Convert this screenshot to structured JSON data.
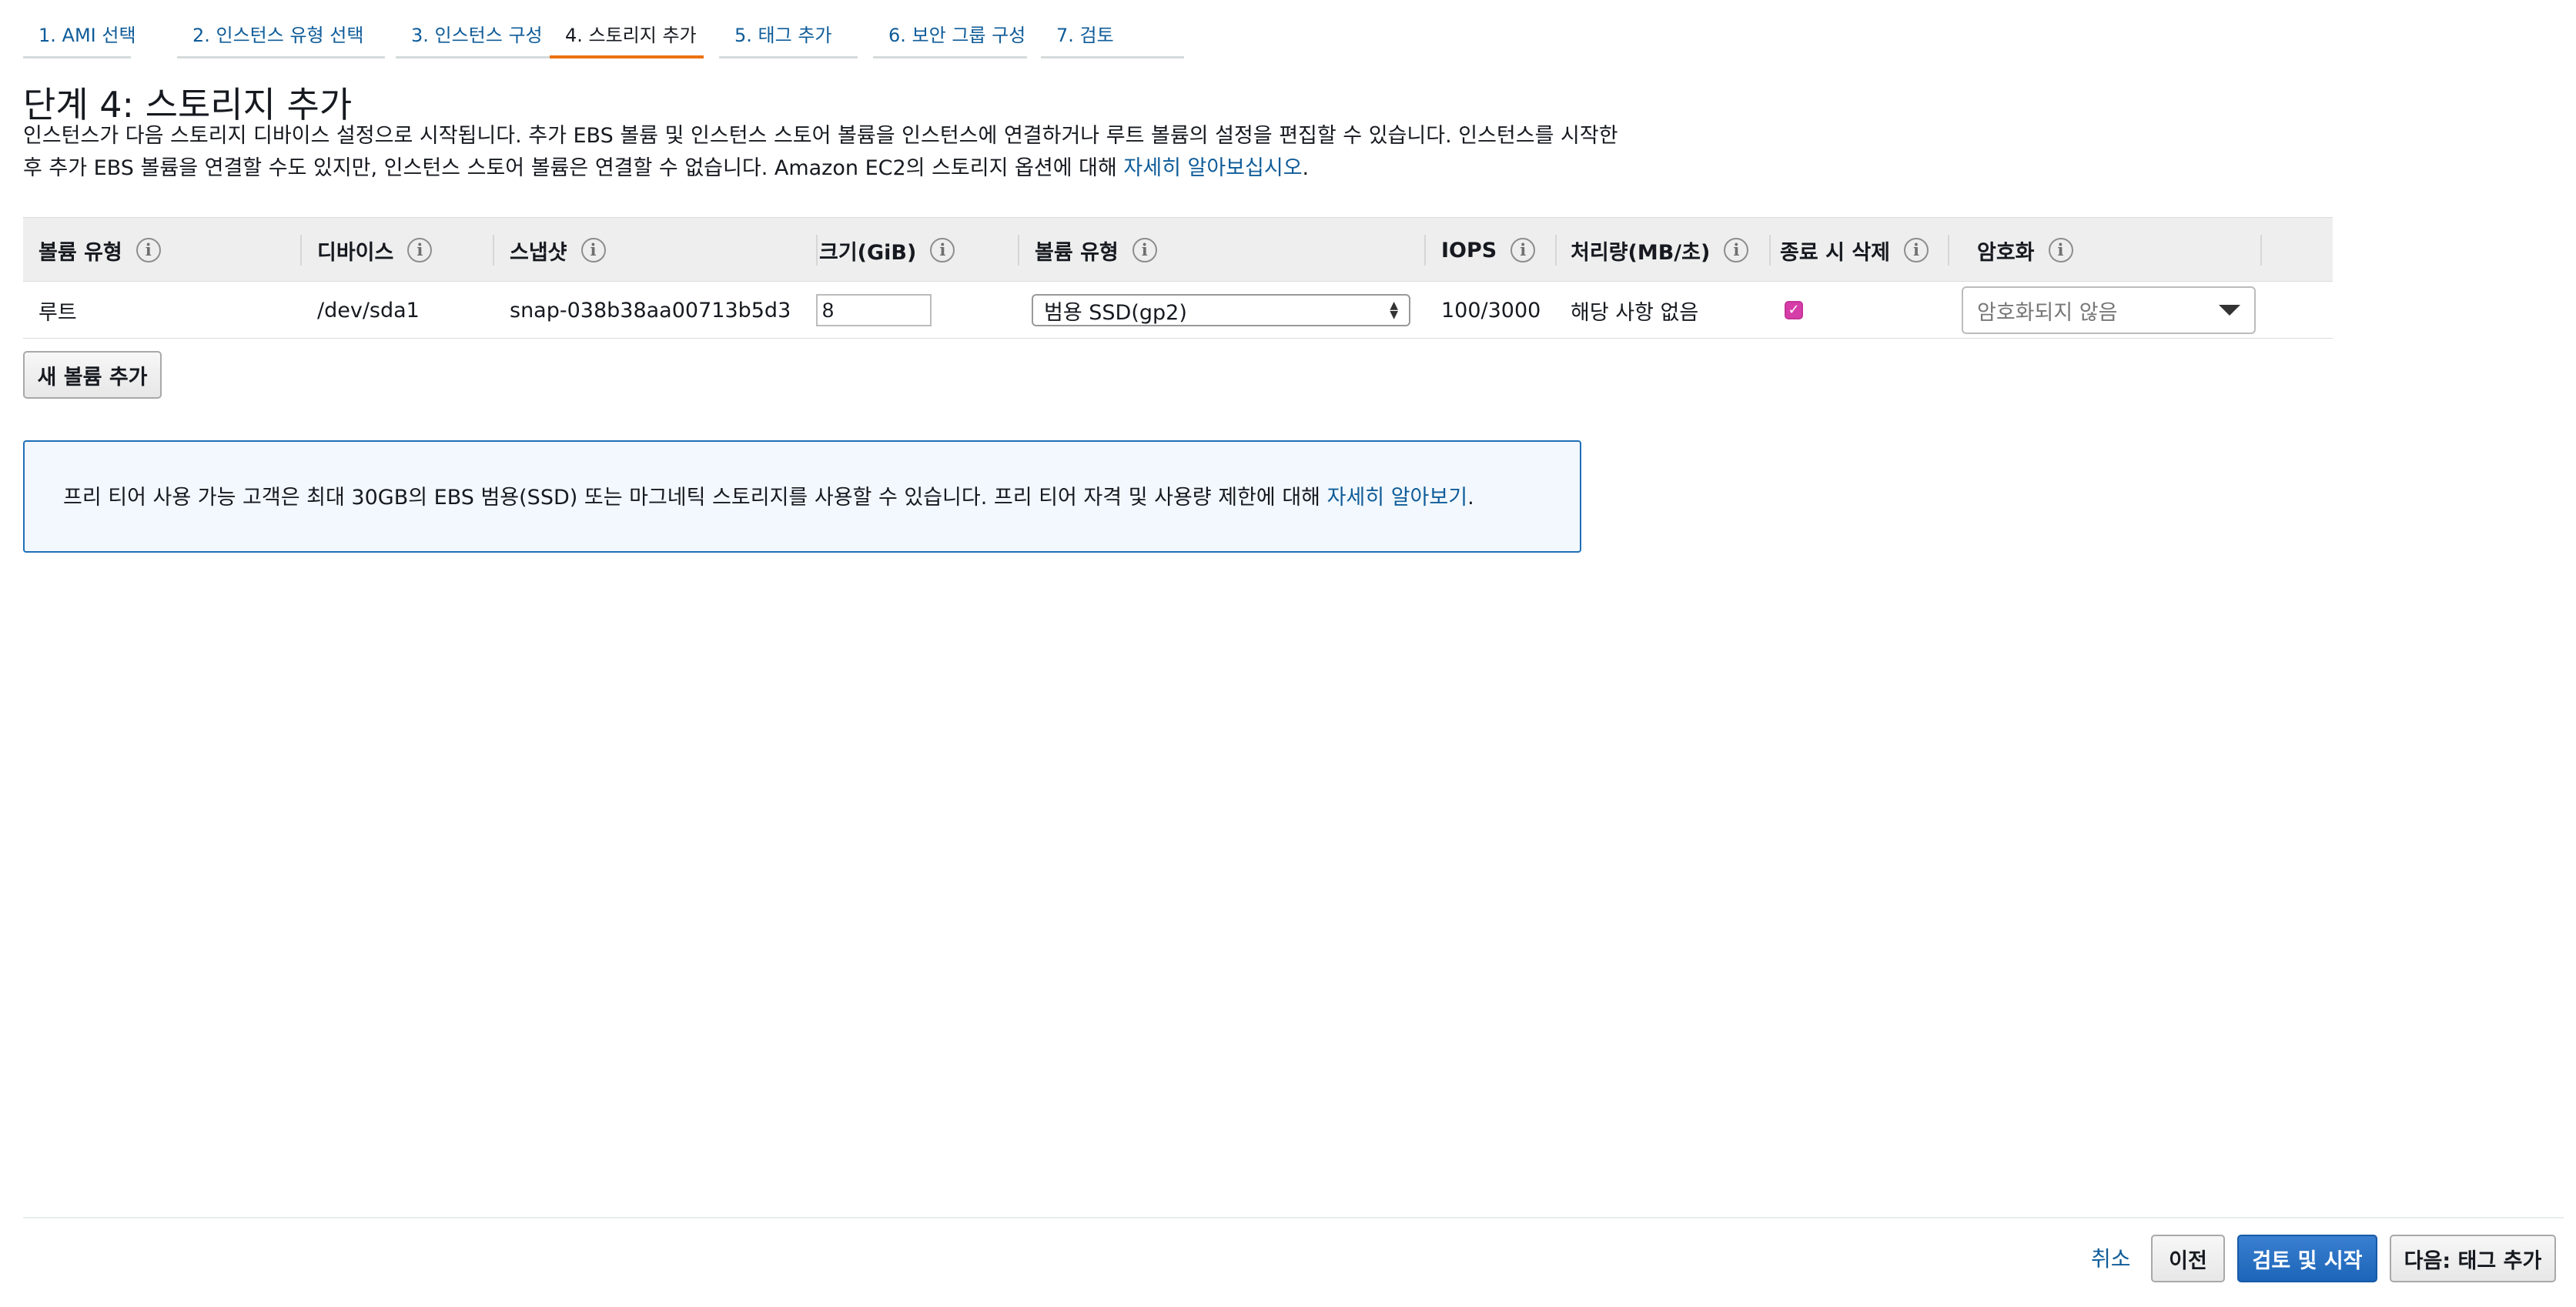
{
  "tabs": [
    {
      "label": "1. AMI 선택",
      "active": false
    },
    {
      "label": "2. 인스턴스 유형 선택",
      "active": false
    },
    {
      "label": "3. 인스턴스 구성",
      "active": false
    },
    {
      "label": "4. 스토리지 추가",
      "active": true
    },
    {
      "label": "5. 태그 추가",
      "active": false
    },
    {
      "label": "6. 보안 그룹 구성",
      "active": false
    },
    {
      "label": "7. 검토",
      "active": false
    }
  ],
  "page": {
    "title": "단계 4: 스토리지 추가",
    "description_line1": "인스턴스가 다음 스토리지 디바이스 설정으로 시작됩니다. 추가 EBS 볼륨 및 인스턴스 스토어 볼륨을 인스턴스에 연결하거나 루트 볼륨의 설정을 편집할 수 있습니다. 인스턴스를 시작한",
    "description_line2": "후 추가 EBS 볼륨을 연결할 수도 있지만, 인스턴스 스토어 볼륨은 연결할 수 없습니다. Amazon EC2의 스토리지 옵션에 대해 ",
    "description_link": "자세히 알아보십시오",
    "description_end": "."
  },
  "table": {
    "headers": {
      "volume_type": "볼륨 유형",
      "device": "디바이스",
      "snapshot": "스냅샷",
      "size": "크기(GiB)",
      "volume_kind": "볼륨 유형",
      "iops": "IOPS",
      "throughput": "처리량(MB/초)",
      "delete_on_termination": "종료 시 삭제",
      "encryption": "암호화"
    },
    "info_icon": "i",
    "row": {
      "volume_type": "루트",
      "device": "/dev/sda1",
      "snapshot": "snap-038b38aa00713b5d3",
      "size": "8",
      "volume_kind": "범용 SSD(gp2)",
      "iops": "100/3000",
      "throughput": "해당 사항 없음",
      "delete_on_termination": true,
      "encryption": "암호화되지 않음"
    }
  },
  "buttons": {
    "add_volume": "새 볼륨 추가",
    "cancel": "취소",
    "previous": "이전",
    "review_launch": "검토 및 시작",
    "next": "다음: 태그 추가"
  },
  "notice": {
    "text": "프리 티어 사용 가능 고객은 최대 30GB의 EBS 범용(SSD) 또는 마그네틱 스토리지를 사용할 수 있습니다. 프리 티어 자격 및 사용량 제한에 대해 ",
    "link": "자세히 알아보기",
    "end": "."
  },
  "colors": {
    "accent_tab": "#ec7211",
    "link": "#0f5c99",
    "primary_button": "#1c65b8",
    "checkbox": "#d63da9",
    "notice_border": "#1f6fb8",
    "notice_bg": "#f2f8fd"
  }
}
